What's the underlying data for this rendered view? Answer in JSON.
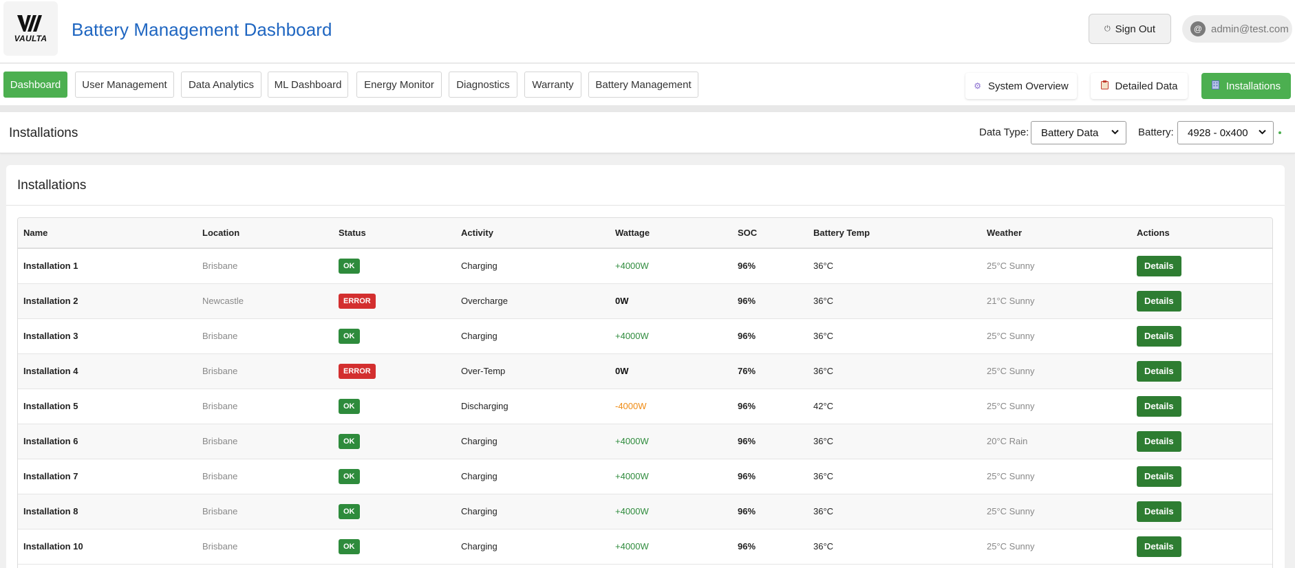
{
  "header": {
    "logo_text": "VAULTA",
    "title": "Battery Management Dashboard",
    "sign_out_label": "Sign Out",
    "user_avatar": "@",
    "user_email": "admin@test.com"
  },
  "nav": {
    "tabs": [
      {
        "label": "Dashboard",
        "active": true
      },
      {
        "label": "User Management",
        "active": false
      },
      {
        "label": "Data Analytics",
        "active": false
      },
      {
        "label": "ML Dashboard",
        "active": false
      },
      {
        "label": "Energy Monitor",
        "active": false
      },
      {
        "label": "Diagnostics",
        "active": false
      },
      {
        "label": "Warranty",
        "active": false
      },
      {
        "label": "Battery Management",
        "active": false
      }
    ],
    "views": [
      {
        "label": "System Overview",
        "icon": "gear-icon",
        "active": false
      },
      {
        "label": "Detailed Data",
        "icon": "clipboard-icon",
        "active": false
      },
      {
        "label": "Installations",
        "icon": "building-icon",
        "active": true
      }
    ]
  },
  "subheader": {
    "title": "Installations",
    "data_type_label": "Data Type:",
    "data_type_value": "Battery Data",
    "battery_label": "Battery:",
    "battery_value": "4928 - 0x400"
  },
  "card": {
    "title": "Installations"
  },
  "table": {
    "columns": [
      "Name",
      "Location",
      "Status",
      "Activity",
      "Wattage",
      "SOC",
      "Battery Temp",
      "Weather",
      "Actions"
    ],
    "action_label": "Details",
    "rows": [
      {
        "name": "Installation 1",
        "location": "Brisbane",
        "status": "OK",
        "activity": "Charging",
        "wattage": "+4000W",
        "soc": "96%",
        "temp": "36°C",
        "weather": "25°C Sunny"
      },
      {
        "name": "Installation 2",
        "location": "Newcastle",
        "status": "ERROR",
        "activity": "Overcharge",
        "wattage": "0W",
        "soc": "96%",
        "temp": "36°C",
        "weather": "21°C Sunny"
      },
      {
        "name": "Installation 3",
        "location": "Brisbane",
        "status": "OK",
        "activity": "Charging",
        "wattage": "+4000W",
        "soc": "96%",
        "temp": "36°C",
        "weather": "25°C Sunny"
      },
      {
        "name": "Installation 4",
        "location": "Brisbane",
        "status": "ERROR",
        "activity": "Over-Temp",
        "wattage": "0W",
        "soc": "76%",
        "temp": "36°C",
        "weather": "25°C Sunny"
      },
      {
        "name": "Installation 5",
        "location": "Brisbane",
        "status": "OK",
        "activity": "Discharging",
        "wattage": "-4000W",
        "soc": "96%",
        "temp": "42°C",
        "weather": "25°C Sunny"
      },
      {
        "name": "Installation 6",
        "location": "Brisbane",
        "status": "OK",
        "activity": "Charging",
        "wattage": "+4000W",
        "soc": "96%",
        "temp": "36°C",
        "weather": "20°C Rain"
      },
      {
        "name": "Installation 7",
        "location": "Brisbane",
        "status": "OK",
        "activity": "Charging",
        "wattage": "+4000W",
        "soc": "96%",
        "temp": "36°C",
        "weather": "25°C Sunny"
      },
      {
        "name": "Installation 8",
        "location": "Brisbane",
        "status": "OK",
        "activity": "Charging",
        "wattage": "+4000W",
        "soc": "96%",
        "temp": "36°C",
        "weather": "25°C Sunny"
      },
      {
        "name": "Installation 10",
        "location": "Brisbane",
        "status": "OK",
        "activity": "Charging",
        "wattage": "+4000W",
        "soc": "96%",
        "temp": "36°C",
        "weather": "25°C Sunny"
      }
    ]
  },
  "colors": {
    "brand_blue": "#1f66c1",
    "accent_green": "#4caf50",
    "ok_green": "#2e8b3c",
    "error_red": "#d32f2f",
    "discharge_orange": "#ef8a12"
  }
}
